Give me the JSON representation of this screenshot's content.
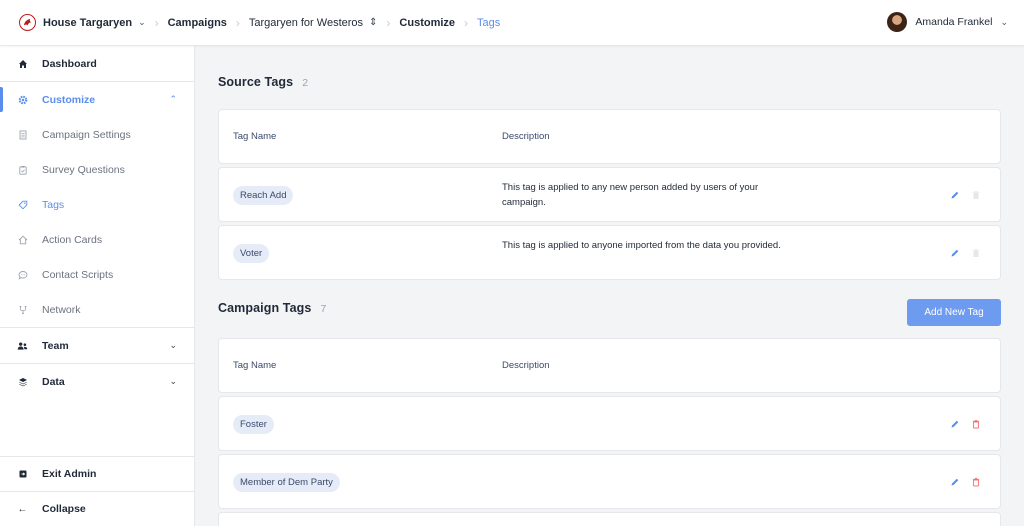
{
  "header": {
    "org_name": "House Targaryen",
    "breadcrumbs": [
      "Campaigns",
      "Targaryen for Westeros",
      "Customize",
      "Tags"
    ],
    "user_name": "Amanda Frankel"
  },
  "sidebar": {
    "items": [
      {
        "label": "Dashboard",
        "icon": "home-icon"
      },
      {
        "label": "Customize",
        "icon": "gear-icon"
      },
      {
        "label": "Campaign Settings",
        "icon": "document-icon"
      },
      {
        "label": "Survey Questions",
        "icon": "clipboard-icon"
      },
      {
        "label": "Tags",
        "icon": "tag-icon"
      },
      {
        "label": "Action Cards",
        "icon": "house-outline-icon"
      },
      {
        "label": "Contact Scripts",
        "icon": "chat-icon"
      },
      {
        "label": "Network",
        "icon": "network-icon"
      },
      {
        "label": "Team",
        "icon": "users-icon"
      },
      {
        "label": "Data",
        "icon": "layers-icon"
      }
    ],
    "bottom": [
      {
        "label": "Exit Admin",
        "icon": "exit-icon"
      },
      {
        "label": "Collapse",
        "icon": "arrow-left-icon"
      }
    ]
  },
  "source_tags": {
    "title": "Source Tags",
    "count": "2",
    "columns": [
      "Tag Name",
      "Description"
    ],
    "rows": [
      {
        "name": "Reach Add",
        "description": "This tag is applied to any new person added by users of your campaign."
      },
      {
        "name": "Voter",
        "description": "This tag is applied to anyone imported from the data you provided."
      }
    ]
  },
  "campaign_tags": {
    "title": "Campaign Tags",
    "count": "7",
    "add_button": "Add New Tag",
    "columns": [
      "Tag Name",
      "Description"
    ],
    "rows": [
      {
        "name": "Foster",
        "description": ""
      },
      {
        "name": "Member of Dem Party",
        "description": ""
      }
    ]
  },
  "colors": {
    "accent": "#5a8dee",
    "button": "#6d9bf0",
    "pill_bg": "#e5ecf8",
    "delete": "#f87171",
    "brand_red": "#b91c1c"
  }
}
